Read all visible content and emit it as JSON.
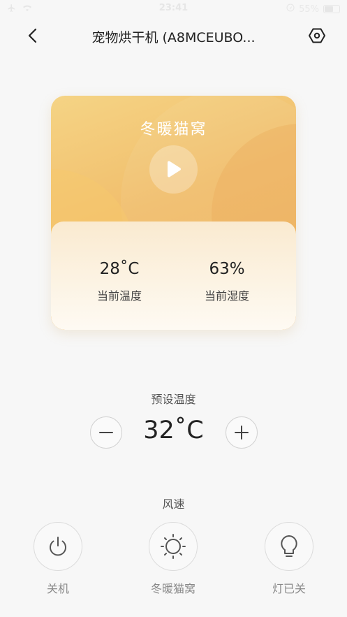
{
  "status_bar": {
    "time": "23:41",
    "battery": "55%"
  },
  "nav": {
    "title": "宠物烘干机 (A8MCEUBO..."
  },
  "card": {
    "mode_title": "冬暖猫窝",
    "temperature": {
      "value": "28˚C",
      "label": "当前温度"
    },
    "humidity": {
      "value": "63%",
      "label": "当前湿度"
    }
  },
  "preset": {
    "label": "预设温度",
    "value": "32˚C"
  },
  "wind": {
    "label": "风速"
  },
  "controls": [
    {
      "label": "关机",
      "icon": "power-icon"
    },
    {
      "label": "冬暖猫窝",
      "icon": "sun-icon"
    },
    {
      "label": "灯已关",
      "icon": "bulb-icon"
    }
  ],
  "colors": {
    "card_top": "#f1be6c",
    "card_bottom": "#fcf3e3",
    "background": "#f7f7f7"
  }
}
